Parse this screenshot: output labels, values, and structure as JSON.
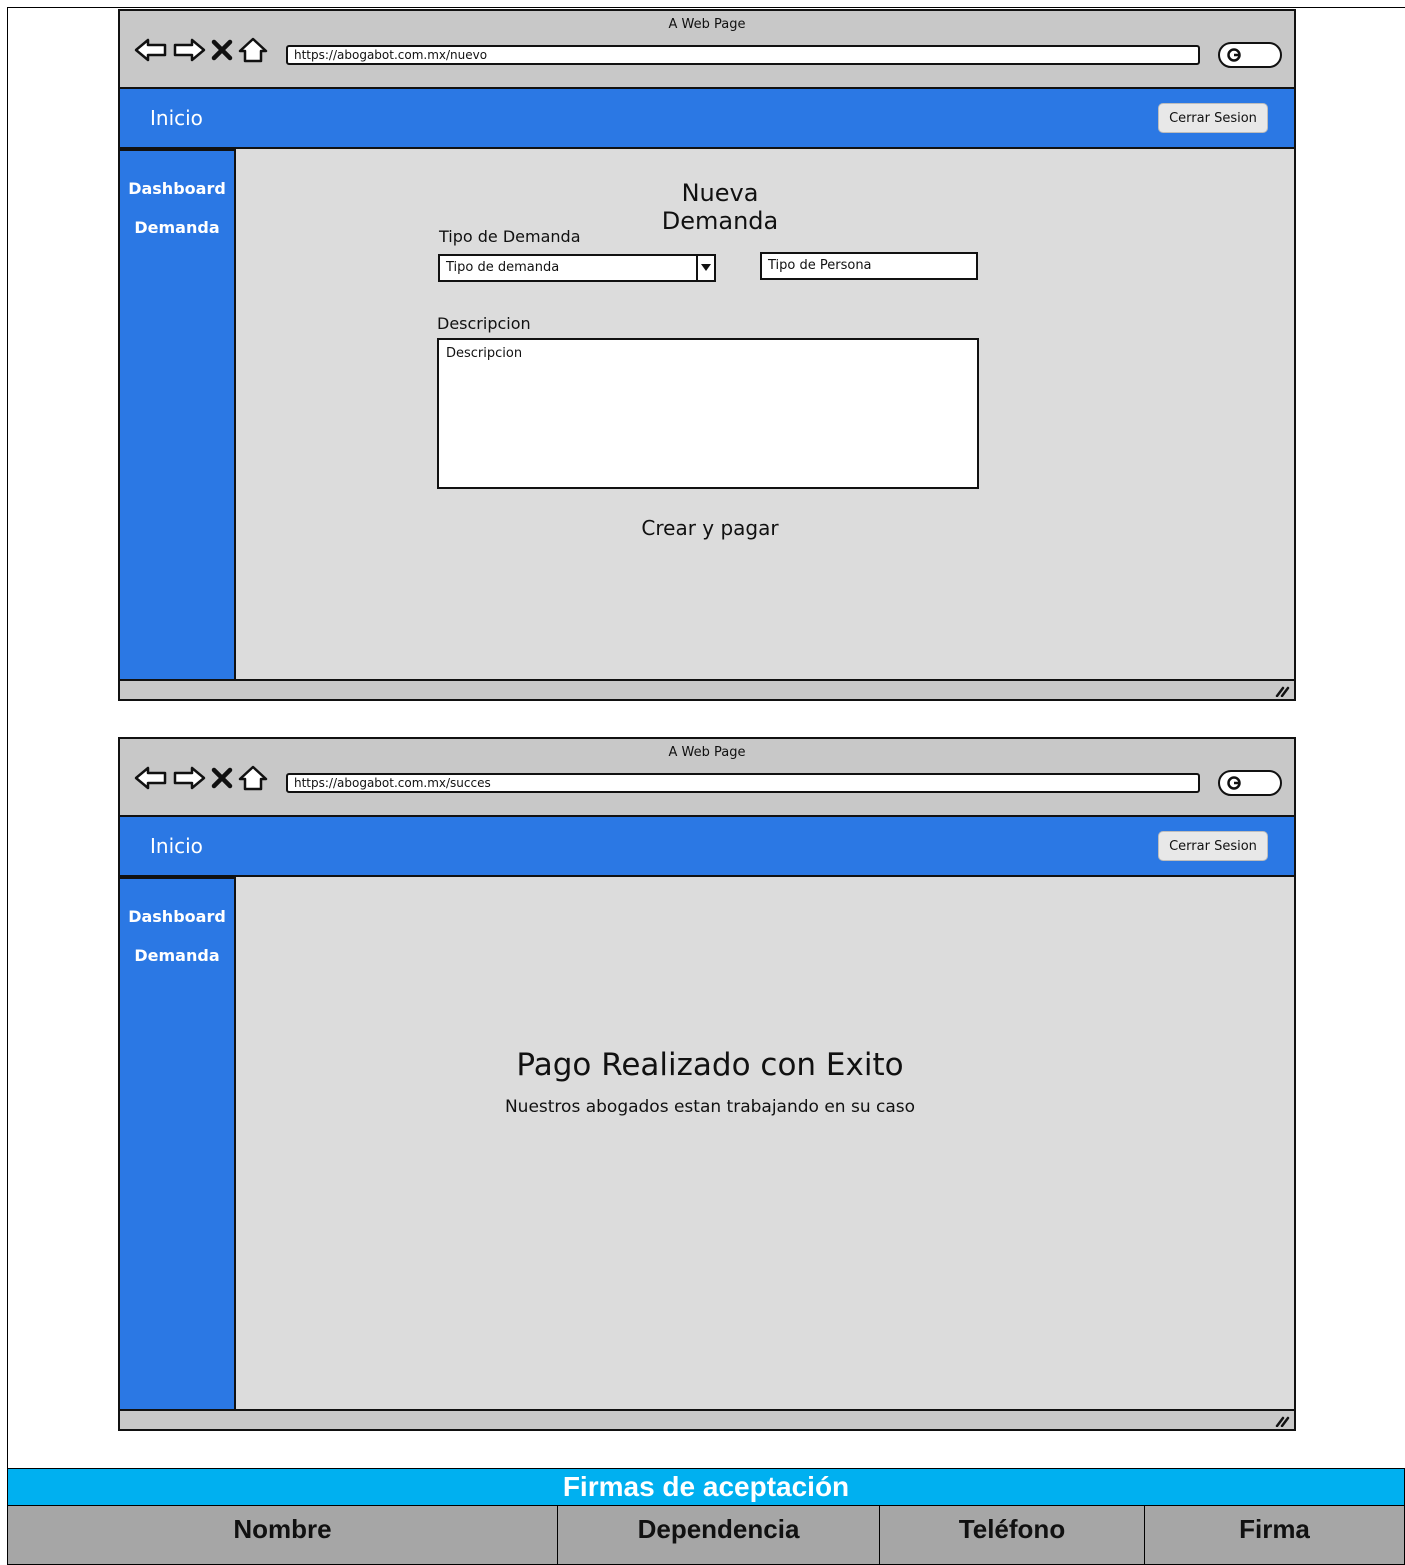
{
  "screen_1": {
    "window_title": "A Web Page",
    "url": "https://abogabot.com.mx/nuevo",
    "header": {
      "home_label": "Inicio",
      "logout_label": "Cerrar Sesion"
    },
    "sidebar": {
      "items": [
        {
          "label": "Dashboard"
        },
        {
          "label": "Demanda"
        }
      ]
    },
    "form": {
      "title": "Nueva Demanda",
      "tipo_demanda_label": "Tipo de Demanda",
      "tipo_demanda_value": "Tipo de demanda",
      "tipo_persona_value": "Tipo de Persona",
      "descripcion_label": "Descripcion",
      "descripcion_value": "Descripcion",
      "submit_label": "Crear y pagar"
    }
  },
  "screen_2": {
    "window_title": "A Web Page",
    "url": "https://abogabot.com.mx/succes",
    "header": {
      "home_label": "Inicio",
      "logout_label": "Cerrar Sesion"
    },
    "sidebar": {
      "items": [
        {
          "label": "Dashboard"
        },
        {
          "label": "Demanda"
        }
      ]
    },
    "message": {
      "title": "Pago Realizado con Exito",
      "subtitle": "Nuestros abogados estan trabajando en su caso"
    }
  },
  "signatures": {
    "title": "Firmas de aceptación",
    "columns": [
      "Nombre",
      "Dependencia",
      "Teléfono",
      "Firma"
    ]
  },
  "colors": {
    "brand_blue": "#2b78e4",
    "content_gray": "#dcdcdc",
    "table_banner": "#00b0f0",
    "table_header": "#a6a6a6"
  }
}
